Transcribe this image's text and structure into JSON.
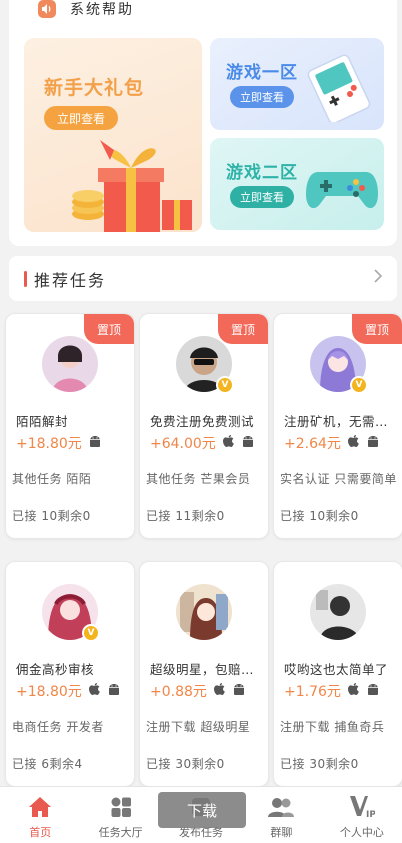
{
  "help": {
    "label": "系统帮助",
    "icon": "speaker-icon"
  },
  "banners": {
    "gift": {
      "title": "新手大礼包",
      "button": "立即查看"
    },
    "zone1": {
      "title": "游戏一区",
      "button": "立即查看"
    },
    "zone2": {
      "title": "游戏二区",
      "button": "立即查看"
    }
  },
  "recommend": {
    "title": "推荐任务"
  },
  "tasks": [
    {
      "pin": "置顶",
      "name": "陌陌解封",
      "price": "+18.80元",
      "category": "其他任务 陌陌",
      "stat": "已接 10剩余0",
      "avatar": "pink",
      "verified": false
    },
    {
      "pin": "置顶",
      "name": "免费注册免费测试",
      "price": "+64.00元",
      "category": "其他任务 芒果会员",
      "stat": "已接 11剩余0",
      "avatar": "dark",
      "verified": true
    },
    {
      "pin": "置顶",
      "name": "注册矿机，无需实名",
      "price": "+2.64元",
      "category": "实名认证 只需要简单",
      "stat": "已接 10剩余0",
      "avatar": "purple",
      "verified": true
    },
    {
      "pin": "",
      "name": "佣金高秒审核",
      "price": "+18.80元",
      "category": "电商任务 开发者",
      "stat": "已接 6剩余4",
      "avatar": "red",
      "verified": true
    },
    {
      "pin": "",
      "name": "超级明星，包赔死的",
      "price": "+0.88元",
      "category": "注册下载 超级明星",
      "stat": "已接 30剩余0",
      "avatar": "anime",
      "verified": false
    },
    {
      "pin": "",
      "name": "哎哟这也太简单了",
      "price": "+1.76元",
      "category": "注册下载 捕鱼奇兵",
      "stat": "已接 30剩余0",
      "avatar": "gray",
      "verified": false
    }
  ],
  "tabs": [
    {
      "label": "首页",
      "icon": "home-icon"
    },
    {
      "label": "任务大厅",
      "icon": "grid-icon"
    },
    {
      "label": "发布任务",
      "icon": "publish-icon"
    },
    {
      "label": "群聊",
      "icon": "group-chat-icon"
    },
    {
      "label": "个人中心",
      "icon": "vip-icon"
    }
  ],
  "toast": {
    "text": "下载"
  },
  "colors": {
    "accent": "#e85a4f",
    "price": "#f08648"
  }
}
